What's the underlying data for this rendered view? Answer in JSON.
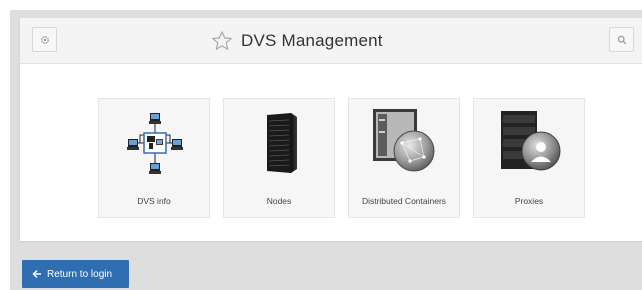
{
  "header": {
    "title": "DVS Management",
    "settings_icon": "gear-icon",
    "search_icon": "search-icon",
    "favorite_icon": "star-icon"
  },
  "tiles": [
    {
      "label": "DVS info",
      "icon": "network-diagram-icon"
    },
    {
      "label": "Nodes",
      "icon": "server-rack-icon"
    },
    {
      "label": "Distributed Containers",
      "icon": "container-globe-icon"
    },
    {
      "label": "Proxies",
      "icon": "proxy-server-icon"
    }
  ],
  "footer": {
    "return_label": "Return to login",
    "return_icon": "arrow-left-icon"
  },
  "colors": {
    "accent": "#2f6fb1",
    "backdrop": "#dedede",
    "tile_background": "#f6f6f6"
  }
}
